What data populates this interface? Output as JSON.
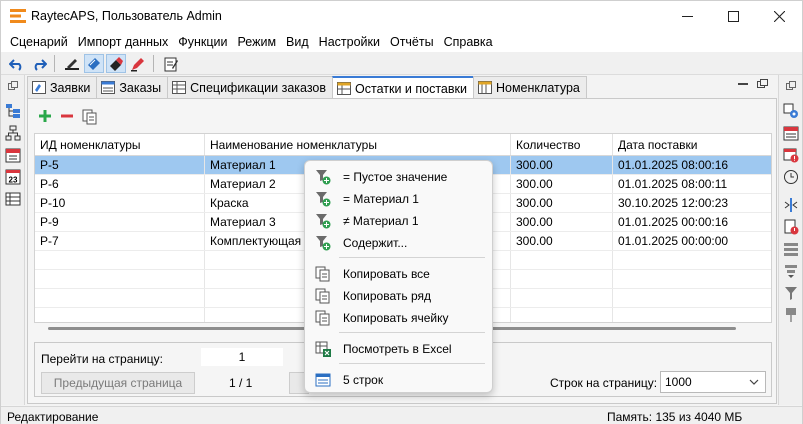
{
  "window": {
    "title": "RaytecAPS, Пользователь Admin",
    "controls": [
      "minimize",
      "maximize",
      "close"
    ]
  },
  "menu": [
    "Сценарий",
    "Импорт данных",
    "Функции",
    "Режим",
    "Вид",
    "Настройки",
    "Отчёты",
    "Справка"
  ],
  "toolbar_icons": [
    "undo-icon",
    "redo-icon",
    "pen-icon",
    "edit-mode-icon",
    "erase-icon",
    "marker-icon",
    "notes-icon"
  ],
  "tabs": [
    {
      "label": "Заявки",
      "icon": "requests-icon"
    },
    {
      "label": "Заказы",
      "icon": "orders-icon"
    },
    {
      "label": "Спецификации заказов",
      "icon": "specs-icon"
    },
    {
      "label": "Остатки и поставки",
      "icon": "stock-icon",
      "active": true
    },
    {
      "label": "Номенклатура",
      "icon": "nomenclature-icon"
    }
  ],
  "grid": {
    "columns": [
      "ИД номенклатуры",
      "Наименование номенклатуры",
      "Количество",
      "Дата поставки"
    ],
    "rows": [
      [
        "P-5",
        "Материал 1",
        "300.00",
        "01.01.2025 08:00:16"
      ],
      [
        "P-6",
        "Материал 2",
        "300.00",
        "01.01.2025 08:00:11"
      ],
      [
        "P-10",
        "Краска",
        "300.00",
        "30.10.2025 12:00:23"
      ],
      [
        "P-9",
        "Материал 3",
        "300.00",
        "01.01.2025 00:00:16"
      ],
      [
        "P-7",
        "Комплектующая",
        "300.00",
        "01.01.2025 00:00:00"
      ]
    ],
    "selected_row": 0
  },
  "context_menu": {
    "filter_items": [
      "= Пустое значение",
      "= Материал 1",
      "≠ Материал 1",
      "Содержит..."
    ],
    "copy_items": [
      "Копировать все",
      "Копировать ряд",
      "Копировать ячейку"
    ],
    "excel_item": "Посмотреть в Excel",
    "rows_item": "5 строк"
  },
  "pager": {
    "goto_label": "Перейти на страницу:",
    "goto_value": "1",
    "prev_label": "Предыдущая страница",
    "page_count": "1 / 1",
    "rows_per_page_label": "Строк на страницу:",
    "rows_per_page_value": "1000"
  },
  "status": {
    "mode": "Редактирование",
    "memory": "Память: 135 из 4040 МБ"
  },
  "colors": {
    "accent": "#3a7bd5",
    "selected_row": "#9ec8f0",
    "filter_green": "#2e9e4f",
    "add_green": "#2aa84a",
    "remove_red": "#d9363e"
  }
}
